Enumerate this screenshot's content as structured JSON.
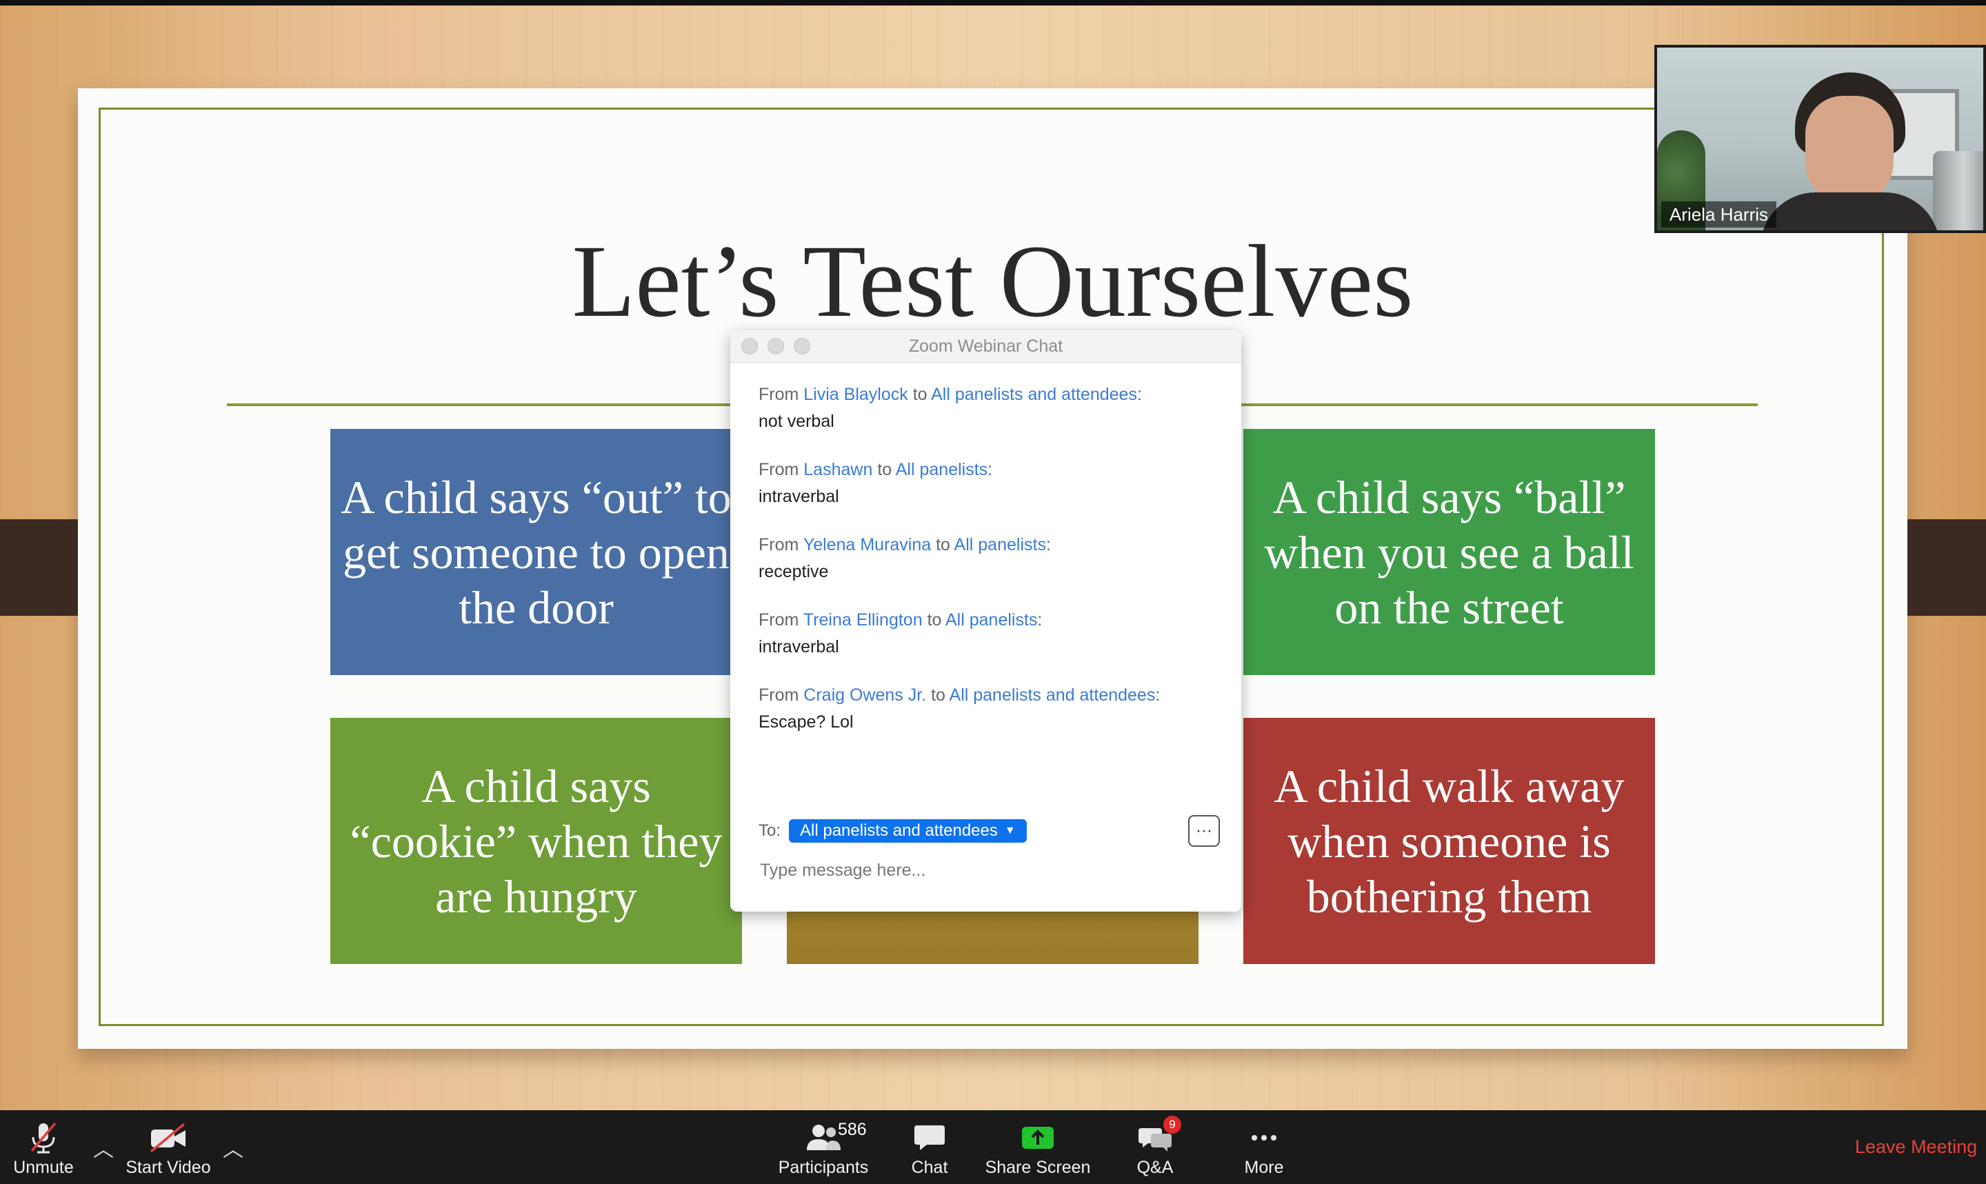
{
  "slide": {
    "title": "Let’s Test Ourselves",
    "cards": [
      {
        "text": "A child says “out” to get someone to open the door",
        "color": "#4a6fa5"
      },
      {
        "text": "A child says “ball” when you see a ball on the street",
        "color": "#3f9d4a"
      },
      {
        "text": "A child says “cookie” when they are hungry",
        "color": "#6f9e38"
      },
      {
        "text": "",
        "color": "#a8872e"
      },
      {
        "text": "A child walk away when someone is bothering them",
        "color": "#aa3a34"
      }
    ],
    "frame_color": "#7e8a2e"
  },
  "webcam": {
    "name": "Ariela Harris"
  },
  "chat": {
    "title": "Zoom Webinar Chat",
    "messages": [
      {
        "from_label": "From",
        "sender": "Livia Blaylock",
        "to_label": "to",
        "recipient": "All panelists and attendees",
        "text": "not verbal"
      },
      {
        "from_label": "From",
        "sender": "Lashawn",
        "to_label": "to",
        "recipient": "All panelists",
        "text": "intraverbal"
      },
      {
        "from_label": "From",
        "sender": "Yelena Muravina",
        "to_label": "to",
        "recipient": "All panelists",
        "text": "receptive"
      },
      {
        "from_label": "From",
        "sender": "Treina Ellington",
        "to_label": "to",
        "recipient": "All panelists",
        "text": "intraverbal"
      },
      {
        "from_label": "From",
        "sender": "Craig Owens Jr.",
        "to_label": "to",
        "recipient": "All panelists and attendees",
        "text": "Escape? Lol"
      }
    ],
    "to_label": "To:",
    "to_value": "All panelists and attendees",
    "more_label": "···",
    "input_placeholder": "Type message here..."
  },
  "toolbar": {
    "unmute_label": "Unmute",
    "start_video_label": "Start Video",
    "participants_label": "Participants",
    "participants_count": "586",
    "chat_label": "Chat",
    "share_screen_label": "Share Screen",
    "qa_label": "Q&A",
    "qa_badge": "9",
    "more_label": "More",
    "leave_label": "Leave Meeting"
  },
  "colors": {
    "accent_blue": "#0e72ed",
    "link_blue": "#3b7bd4",
    "share_green": "#23c22f",
    "leave_red": "#e9413b"
  }
}
